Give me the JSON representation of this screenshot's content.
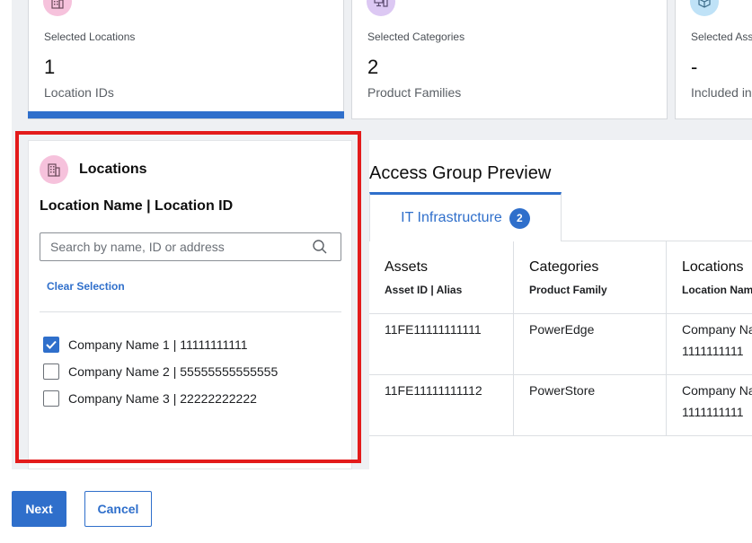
{
  "summary_cards": [
    {
      "caption": "Selected Locations",
      "value": "1",
      "sub": "Location IDs",
      "icon": "building-icon",
      "icon_bg": "#f6c2dc",
      "active": true
    },
    {
      "caption": "Selected Categories",
      "value": "2",
      "sub": "Product Families",
      "icon": "monitor-icon",
      "icon_bg": "#dcc8f3",
      "active": false
    },
    {
      "caption": "Selected Ass",
      "value": "-",
      "sub": "Included in",
      "icon": "cube-icon",
      "icon_bg": "#bfe2f7",
      "active": false
    }
  ],
  "locations_panel": {
    "title": "Locations",
    "subtitle": "Location Name | Location ID",
    "search": {
      "placeholder": "Search by name, ID or address",
      "value": ""
    },
    "clear_label": "Clear Selection",
    "items": [
      {
        "label": "Company Name 1 | 11111111111",
        "checked": true
      },
      {
        "label": "Company Name 2 | 55555555555555",
        "checked": false
      },
      {
        "label": "Company Name 3 | 22222222222",
        "checked": false
      }
    ]
  },
  "preview": {
    "title": "Access Group Preview",
    "tabs": [
      {
        "label": "IT Infrastructure",
        "count": "2"
      }
    ],
    "columns": [
      {
        "header": "Assets",
        "sub": "Asset ID | Alias"
      },
      {
        "header": "Categories",
        "sub": "Product Family"
      },
      {
        "header": "Locations",
        "sub": "Location Name"
      }
    ],
    "rows": [
      {
        "asset": "11FE11111111111",
        "category": "PowerEdge",
        "location_line1": "Company Na",
        "location_line2": "1111111111"
      },
      {
        "asset": "11FE11111111112",
        "category": "PowerStore",
        "location_line1": "Company Na",
        "location_line2": "1111111111"
      }
    ]
  },
  "footer": {
    "next_label": "Next",
    "cancel_label": "Cancel"
  },
  "colors": {
    "accent": "#2f6fcb",
    "highlight": "#e31b1b"
  }
}
